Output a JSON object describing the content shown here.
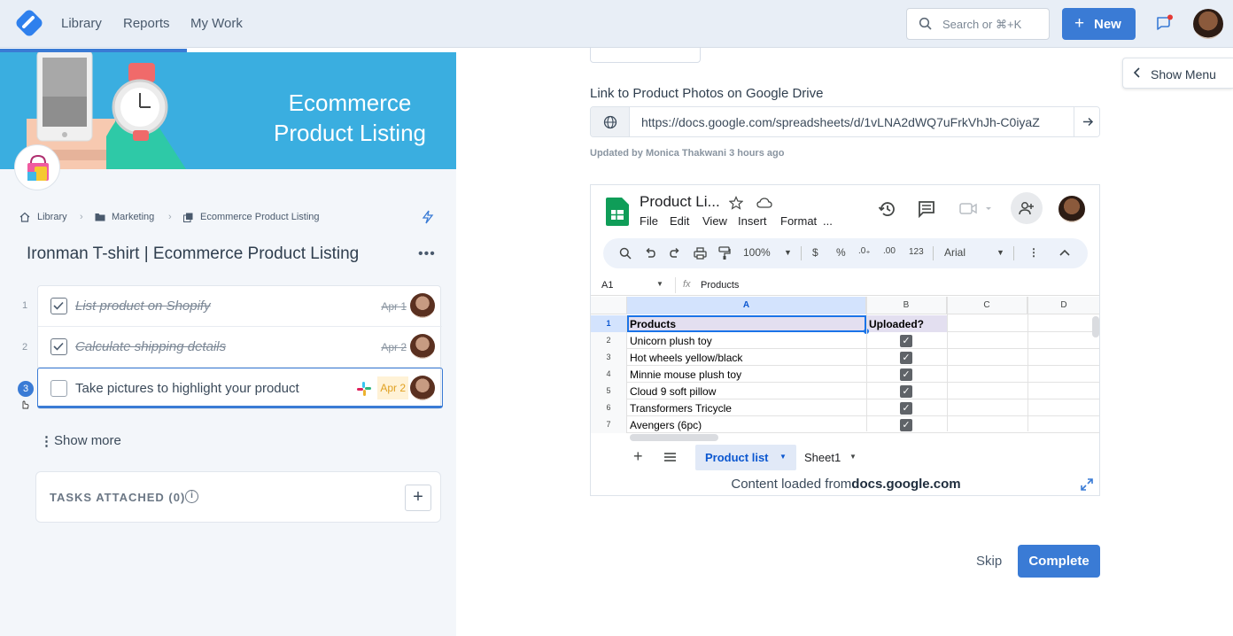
{
  "nav": {
    "links": [
      "Library",
      "Reports",
      "My Work"
    ],
    "search_placeholder": "Search or ⌘+K",
    "new_label": "New"
  },
  "banner": {
    "title_line1": "Ecommerce",
    "title_line2": "Product Listing",
    "color": "#3aaee0"
  },
  "breadcrumb": [
    "Library",
    "Marketing",
    "Ecommerce Product Listing"
  ],
  "page_title": "Ironman T-shirt | Ecommerce Product Listing",
  "tasks": [
    {
      "num": "1",
      "label": "List product on Shopify",
      "date": "Apr 1",
      "done": true
    },
    {
      "num": "2",
      "label": "Calculate shipping details",
      "date": "Apr 2",
      "done": true
    },
    {
      "num": "3",
      "label": "Take pictures to highlight your product",
      "date": "Apr 2",
      "done": false
    }
  ],
  "show_more": "Show more",
  "tasks_attached": "TASKS ATTACHED (0)",
  "show_menu": "Show Menu",
  "field": {
    "label": "Link to Product Photos on Google Drive",
    "url": "https://docs.google.com/spreadsheets/d/1vLNA2dWQ7uFrkVhJh-C0iyaZ",
    "updated": "Updated by Monica Thakwani 3 hours ago"
  },
  "sheet": {
    "title": "Product Li...",
    "menu": [
      "File",
      "Edit",
      "View",
      "Insert",
      "Format",
      "..."
    ],
    "zoom": "100%",
    "font": "Arial",
    "cell_ref": "A1",
    "formula": "Products",
    "columns": [
      "A",
      "B",
      "C",
      "D"
    ],
    "rows": [
      {
        "n": "1",
        "a": "Products",
        "b": "Uploaded?",
        "header": true
      },
      {
        "n": "2",
        "a": "Unicorn plush toy",
        "checked": true
      },
      {
        "n": "3",
        "a": "Hot wheels yellow/black",
        "checked": true
      },
      {
        "n": "4",
        "a": "Minnie mouse plush toy",
        "checked": true
      },
      {
        "n": "5",
        "a": "Cloud 9 soft pillow",
        "checked": true
      },
      {
        "n": "6",
        "a": "Transformers Tricycle",
        "checked": true
      },
      {
        "n": "7",
        "a": "Avengers (6pc)",
        "checked": true
      }
    ],
    "tabs": [
      "Product list",
      "Sheet1"
    ],
    "footer_prefix": "Content loaded from",
    "footer_domain": "docs.google.com"
  },
  "actions": {
    "skip": "Skip",
    "complete": "Complete"
  },
  "colors": {
    "accent": "#3a7bd5"
  }
}
